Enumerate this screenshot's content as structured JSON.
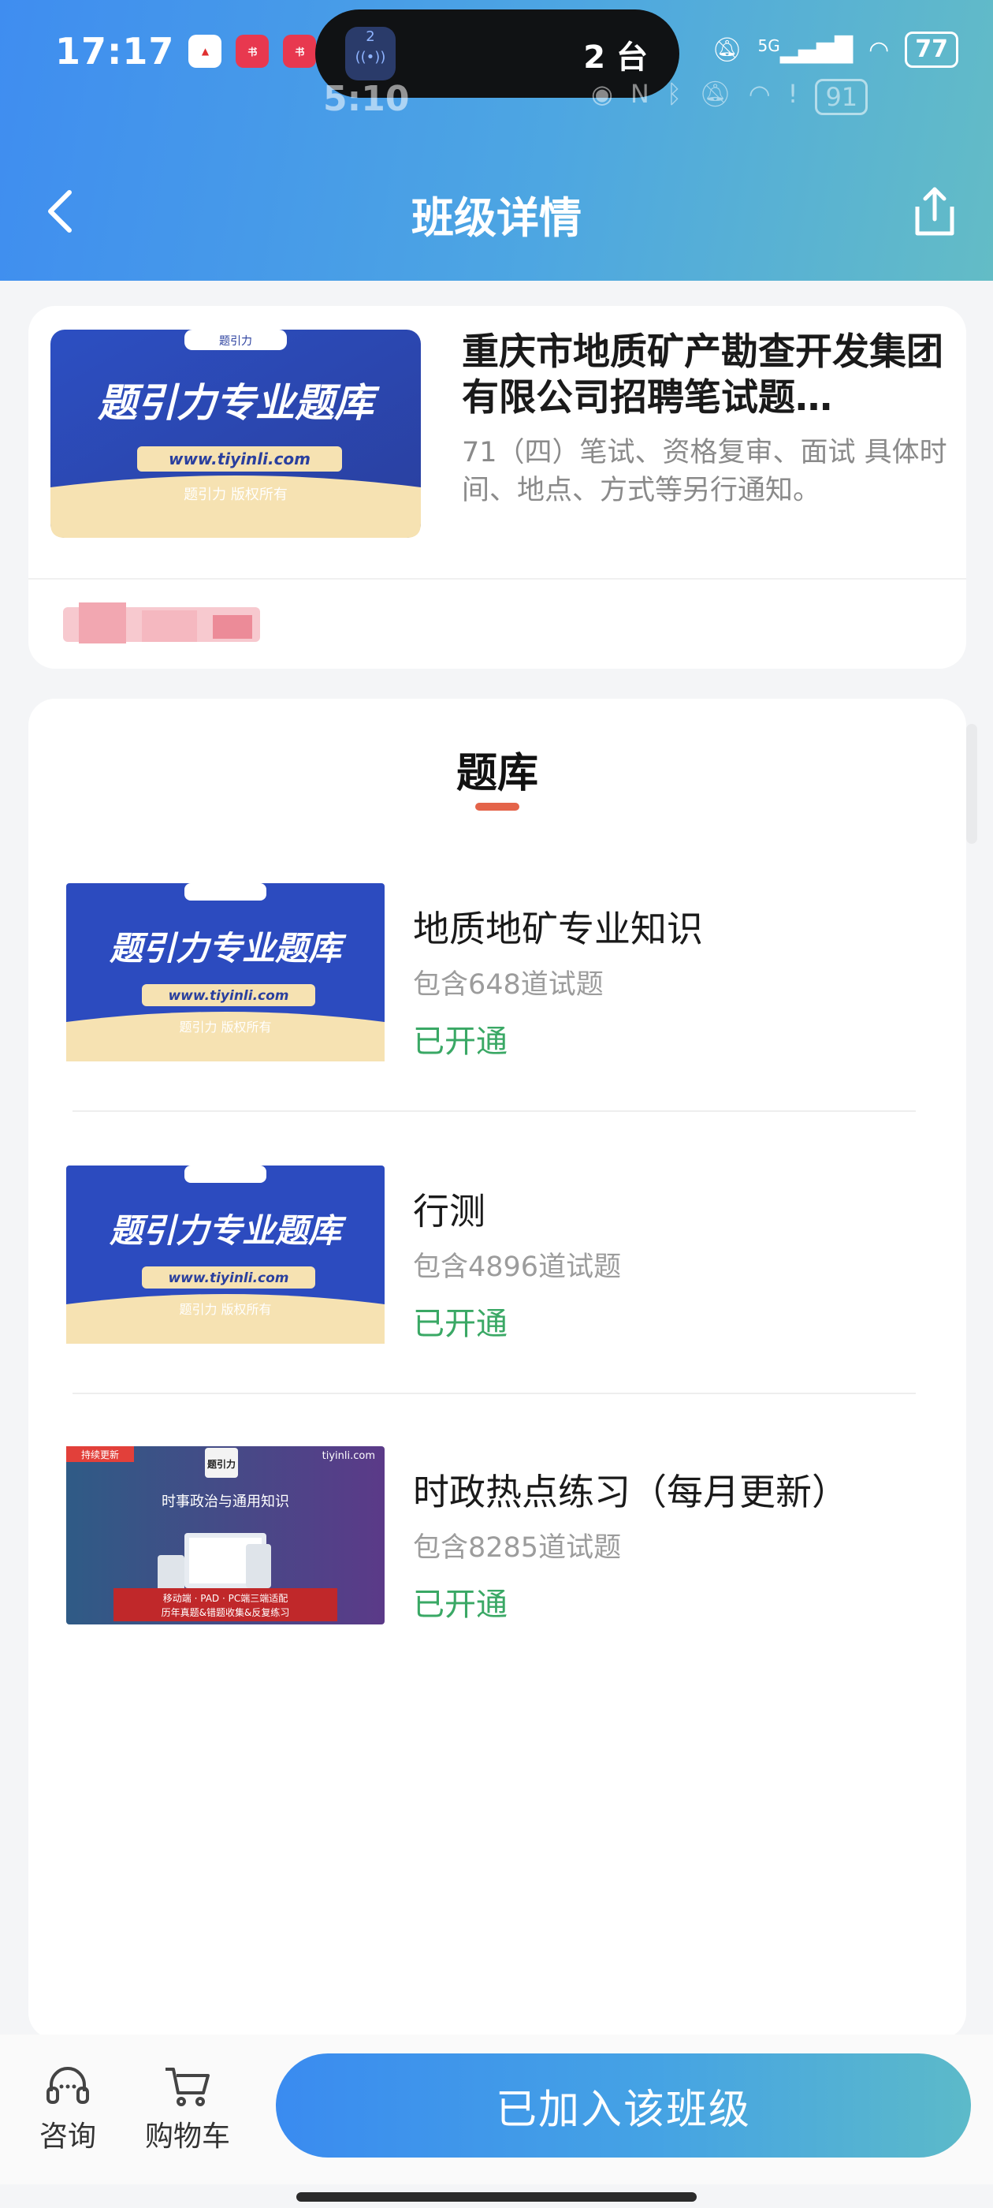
{
  "status_bar": {
    "time": "17:17",
    "dynamic_island_count": "2",
    "dynamic_island_text": "2 台",
    "battery": "77",
    "network": "5G",
    "ghost_time": "5:10",
    "ghost_battery": "91"
  },
  "header": {
    "title": "班级详情",
    "back_icon": "chevron-left-icon",
    "share_icon": "share-icon"
  },
  "class_info": {
    "title": "重庆市地质矿产勘查开发集团有限公司招聘笔试题…",
    "description": "71（四）笔试、资格复审、面试 具体时间、地点、方式等另行通知。",
    "thumb_title": "题引力专业题库",
    "thumb_url": "www.tiyinli.com",
    "thumb_copyright": "题引力 版权所有",
    "thumb_brand": "题引力"
  },
  "question_bank": {
    "title": "题库",
    "items": [
      {
        "name": "地质地矿专业知识",
        "count": "包含648道试题",
        "status": "已开通"
      },
      {
        "name": "行测",
        "count": "包含4896道试题",
        "status": "已开通"
      },
      {
        "name": "时政热点练习（每月更新）",
        "count": "包含8285道试题",
        "status": "已开通"
      }
    ],
    "special_thumb": {
      "tag": "持续更新",
      "site": "tiyinli.com",
      "heading": "时事政治与通用知识",
      "line1": "移动端 · PAD · PC端三端适配",
      "line2": "历年真题&错题收集&反复练习",
      "logo": "题引力"
    }
  },
  "bottom_bar": {
    "consult_label": "咨询",
    "cart_label": "购物车",
    "join_label": "已加入该班级"
  },
  "colors": {
    "accent_blue": "#3f8df0",
    "status_green": "#3aa865",
    "underline": "#e4644a"
  }
}
